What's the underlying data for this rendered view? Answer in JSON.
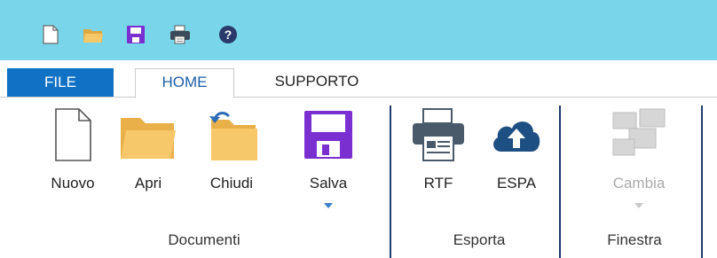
{
  "quick_access": {
    "items": [
      {
        "name": "new-document-icon"
      },
      {
        "name": "open-folder-icon"
      },
      {
        "name": "save-icon"
      },
      {
        "name": "print-icon"
      },
      {
        "name": "help-icon",
        "glyph": "?"
      }
    ]
  },
  "tabs": [
    {
      "label": "FILE"
    },
    {
      "label": "HOME",
      "active": true
    },
    {
      "label": "SUPPORTO"
    }
  ],
  "groups": {
    "documenti": {
      "label": "Documenti",
      "buttons": {
        "nuovo": {
          "label": "Nuovo",
          "icon": "new-document-icon"
        },
        "apri": {
          "label": "Apri",
          "icon": "folder-icon"
        },
        "chiudi": {
          "label": "Chiudi",
          "icon": "close-folder-icon"
        },
        "salva": {
          "label": "Salva",
          "icon": "save-icon",
          "has_dropdown": true
        }
      }
    },
    "esporta": {
      "label": "Esporta",
      "buttons": {
        "rtf": {
          "label": "RTF",
          "icon": "printer-icon"
        },
        "espa": {
          "label": "ESPA",
          "icon": "cloud-upload-icon"
        }
      }
    },
    "finestra": {
      "label": "Finestra",
      "buttons": {
        "cambia": {
          "label": "Cambia",
          "icon": "switch-windows-icon",
          "disabled": true,
          "has_dropdown": true
        }
      }
    }
  },
  "colors": {
    "title_bar": "#79d6ea",
    "file_tab": "#1172c5",
    "save_purple": "#7a2fd0",
    "folder": "#f6c869",
    "separator": "#1f3b6e"
  }
}
